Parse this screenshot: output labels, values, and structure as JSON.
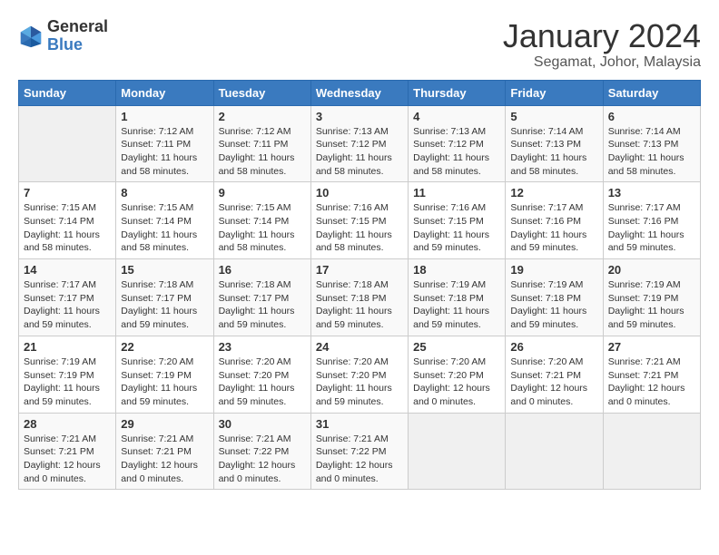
{
  "logo": {
    "line1": "General",
    "line2": "Blue"
  },
  "title": "January 2024",
  "subtitle": "Segamat, Johor, Malaysia",
  "days_of_week": [
    "Sunday",
    "Monday",
    "Tuesday",
    "Wednesday",
    "Thursday",
    "Friday",
    "Saturday"
  ],
  "weeks": [
    [
      {
        "day": "",
        "sunrise": "",
        "sunset": "",
        "daylight": ""
      },
      {
        "day": "1",
        "sunrise": "Sunrise: 7:12 AM",
        "sunset": "Sunset: 7:11 PM",
        "daylight": "Daylight: 11 hours and 58 minutes."
      },
      {
        "day": "2",
        "sunrise": "Sunrise: 7:12 AM",
        "sunset": "Sunset: 7:11 PM",
        "daylight": "Daylight: 11 hours and 58 minutes."
      },
      {
        "day": "3",
        "sunrise": "Sunrise: 7:13 AM",
        "sunset": "Sunset: 7:12 PM",
        "daylight": "Daylight: 11 hours and 58 minutes."
      },
      {
        "day": "4",
        "sunrise": "Sunrise: 7:13 AM",
        "sunset": "Sunset: 7:12 PM",
        "daylight": "Daylight: 11 hours and 58 minutes."
      },
      {
        "day": "5",
        "sunrise": "Sunrise: 7:14 AM",
        "sunset": "Sunset: 7:13 PM",
        "daylight": "Daylight: 11 hours and 58 minutes."
      },
      {
        "day": "6",
        "sunrise": "Sunrise: 7:14 AM",
        "sunset": "Sunset: 7:13 PM",
        "daylight": "Daylight: 11 hours and 58 minutes."
      }
    ],
    [
      {
        "day": "7",
        "sunrise": "Sunrise: 7:15 AM",
        "sunset": "Sunset: 7:14 PM",
        "daylight": "Daylight: 11 hours and 58 minutes."
      },
      {
        "day": "8",
        "sunrise": "Sunrise: 7:15 AM",
        "sunset": "Sunset: 7:14 PM",
        "daylight": "Daylight: 11 hours and 58 minutes."
      },
      {
        "day": "9",
        "sunrise": "Sunrise: 7:15 AM",
        "sunset": "Sunset: 7:14 PM",
        "daylight": "Daylight: 11 hours and 58 minutes."
      },
      {
        "day": "10",
        "sunrise": "Sunrise: 7:16 AM",
        "sunset": "Sunset: 7:15 PM",
        "daylight": "Daylight: 11 hours and 58 minutes."
      },
      {
        "day": "11",
        "sunrise": "Sunrise: 7:16 AM",
        "sunset": "Sunset: 7:15 PM",
        "daylight": "Daylight: 11 hours and 59 minutes."
      },
      {
        "day": "12",
        "sunrise": "Sunrise: 7:17 AM",
        "sunset": "Sunset: 7:16 PM",
        "daylight": "Daylight: 11 hours and 59 minutes."
      },
      {
        "day": "13",
        "sunrise": "Sunrise: 7:17 AM",
        "sunset": "Sunset: 7:16 PM",
        "daylight": "Daylight: 11 hours and 59 minutes."
      }
    ],
    [
      {
        "day": "14",
        "sunrise": "Sunrise: 7:17 AM",
        "sunset": "Sunset: 7:17 PM",
        "daylight": "Daylight: 11 hours and 59 minutes."
      },
      {
        "day": "15",
        "sunrise": "Sunrise: 7:18 AM",
        "sunset": "Sunset: 7:17 PM",
        "daylight": "Daylight: 11 hours and 59 minutes."
      },
      {
        "day": "16",
        "sunrise": "Sunrise: 7:18 AM",
        "sunset": "Sunset: 7:17 PM",
        "daylight": "Daylight: 11 hours and 59 minutes."
      },
      {
        "day": "17",
        "sunrise": "Sunrise: 7:18 AM",
        "sunset": "Sunset: 7:18 PM",
        "daylight": "Daylight: 11 hours and 59 minutes."
      },
      {
        "day": "18",
        "sunrise": "Sunrise: 7:19 AM",
        "sunset": "Sunset: 7:18 PM",
        "daylight": "Daylight: 11 hours and 59 minutes."
      },
      {
        "day": "19",
        "sunrise": "Sunrise: 7:19 AM",
        "sunset": "Sunset: 7:18 PM",
        "daylight": "Daylight: 11 hours and 59 minutes."
      },
      {
        "day": "20",
        "sunrise": "Sunrise: 7:19 AM",
        "sunset": "Sunset: 7:19 PM",
        "daylight": "Daylight: 11 hours and 59 minutes."
      }
    ],
    [
      {
        "day": "21",
        "sunrise": "Sunrise: 7:19 AM",
        "sunset": "Sunset: 7:19 PM",
        "daylight": "Daylight: 11 hours and 59 minutes."
      },
      {
        "day": "22",
        "sunrise": "Sunrise: 7:20 AM",
        "sunset": "Sunset: 7:19 PM",
        "daylight": "Daylight: 11 hours and 59 minutes."
      },
      {
        "day": "23",
        "sunrise": "Sunrise: 7:20 AM",
        "sunset": "Sunset: 7:20 PM",
        "daylight": "Daylight: 11 hours and 59 minutes."
      },
      {
        "day": "24",
        "sunrise": "Sunrise: 7:20 AM",
        "sunset": "Sunset: 7:20 PM",
        "daylight": "Daylight: 11 hours and 59 minutes."
      },
      {
        "day": "25",
        "sunrise": "Sunrise: 7:20 AM",
        "sunset": "Sunset: 7:20 PM",
        "daylight": "Daylight: 12 hours and 0 minutes."
      },
      {
        "day": "26",
        "sunrise": "Sunrise: 7:20 AM",
        "sunset": "Sunset: 7:21 PM",
        "daylight": "Daylight: 12 hours and 0 minutes."
      },
      {
        "day": "27",
        "sunrise": "Sunrise: 7:21 AM",
        "sunset": "Sunset: 7:21 PM",
        "daylight": "Daylight: 12 hours and 0 minutes."
      }
    ],
    [
      {
        "day": "28",
        "sunrise": "Sunrise: 7:21 AM",
        "sunset": "Sunset: 7:21 PM",
        "daylight": "Daylight: 12 hours and 0 minutes."
      },
      {
        "day": "29",
        "sunrise": "Sunrise: 7:21 AM",
        "sunset": "Sunset: 7:21 PM",
        "daylight": "Daylight: 12 hours and 0 minutes."
      },
      {
        "day": "30",
        "sunrise": "Sunrise: 7:21 AM",
        "sunset": "Sunset: 7:22 PM",
        "daylight": "Daylight: 12 hours and 0 minutes."
      },
      {
        "day": "31",
        "sunrise": "Sunrise: 7:21 AM",
        "sunset": "Sunset: 7:22 PM",
        "daylight": "Daylight: 12 hours and 0 minutes."
      },
      {
        "day": "",
        "sunrise": "",
        "sunset": "",
        "daylight": ""
      },
      {
        "day": "",
        "sunrise": "",
        "sunset": "",
        "daylight": ""
      },
      {
        "day": "",
        "sunrise": "",
        "sunset": "",
        "daylight": ""
      }
    ]
  ]
}
